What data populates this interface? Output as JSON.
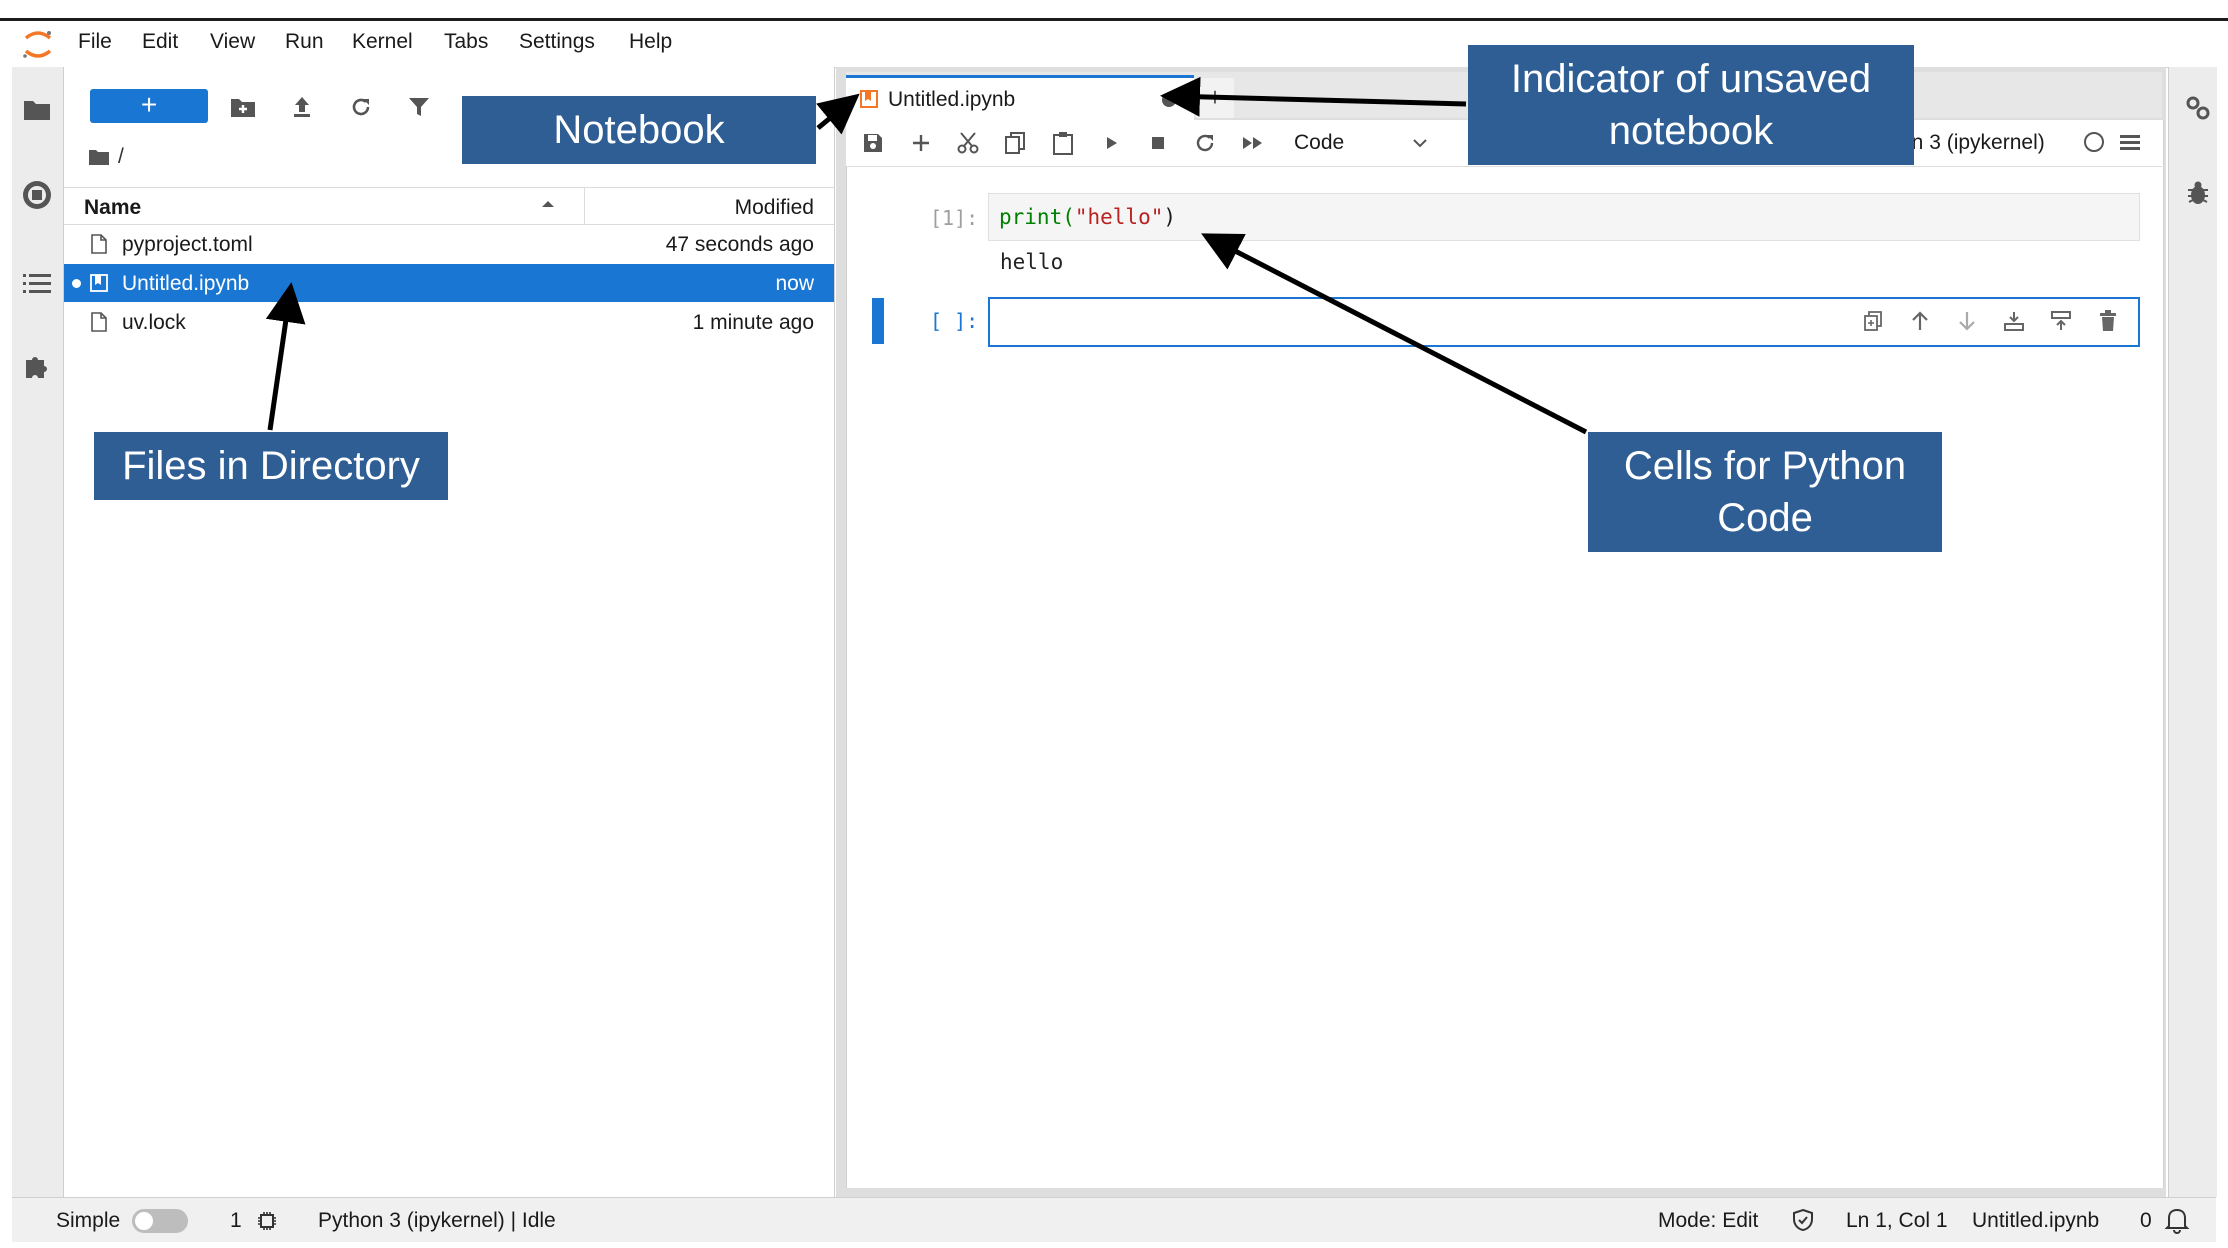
{
  "menu": [
    "File",
    "Edit",
    "View",
    "Run",
    "Kernel",
    "Tabs",
    "Settings",
    "Help"
  ],
  "filebrowser": {
    "new_label": "+",
    "breadcrumb": "/",
    "col_name": "Name",
    "col_modified": "Modified",
    "files": [
      {
        "name": "pyproject.toml",
        "modified": "47 seconds ago"
      },
      {
        "name": "Untitled.ipynb",
        "modified": "now"
      },
      {
        "name": "uv.lock",
        "modified": "1 minute ago"
      }
    ]
  },
  "notebook": {
    "tab_title": "Untitled.ipynb",
    "cell_type": "Code",
    "kernel": "on 3 (ipykernel)",
    "cells": [
      {
        "prompt": "[1]:",
        "code_fn": "print(",
        "code_str": "\"hello\"",
        "code_end": ")",
        "output": "hello"
      },
      {
        "prompt": "[ ]:"
      }
    ]
  },
  "status": {
    "mode_toggle": "Simple",
    "terminals": "1",
    "kernel_status": "Python 3 (ipykernel) | Idle",
    "mode": "Mode: Edit",
    "position": "Ln 1, Col 1",
    "file": "Untitled.ipynb",
    "notifications": "0"
  },
  "annotations": {
    "notebook": "Notebook",
    "unsaved_line1": "Indicator of unsaved",
    "unsaved_line2": "notebook",
    "files_dir": "Files in Directory",
    "cells_line1": "Cells for Python",
    "cells_line2": "Code"
  },
  "colors": {
    "accent": "#1976d2",
    "callout_bg": "#2e5e94",
    "string": "#ba2121",
    "keyword": "#008000",
    "jupyter_orange": "#f37726"
  }
}
